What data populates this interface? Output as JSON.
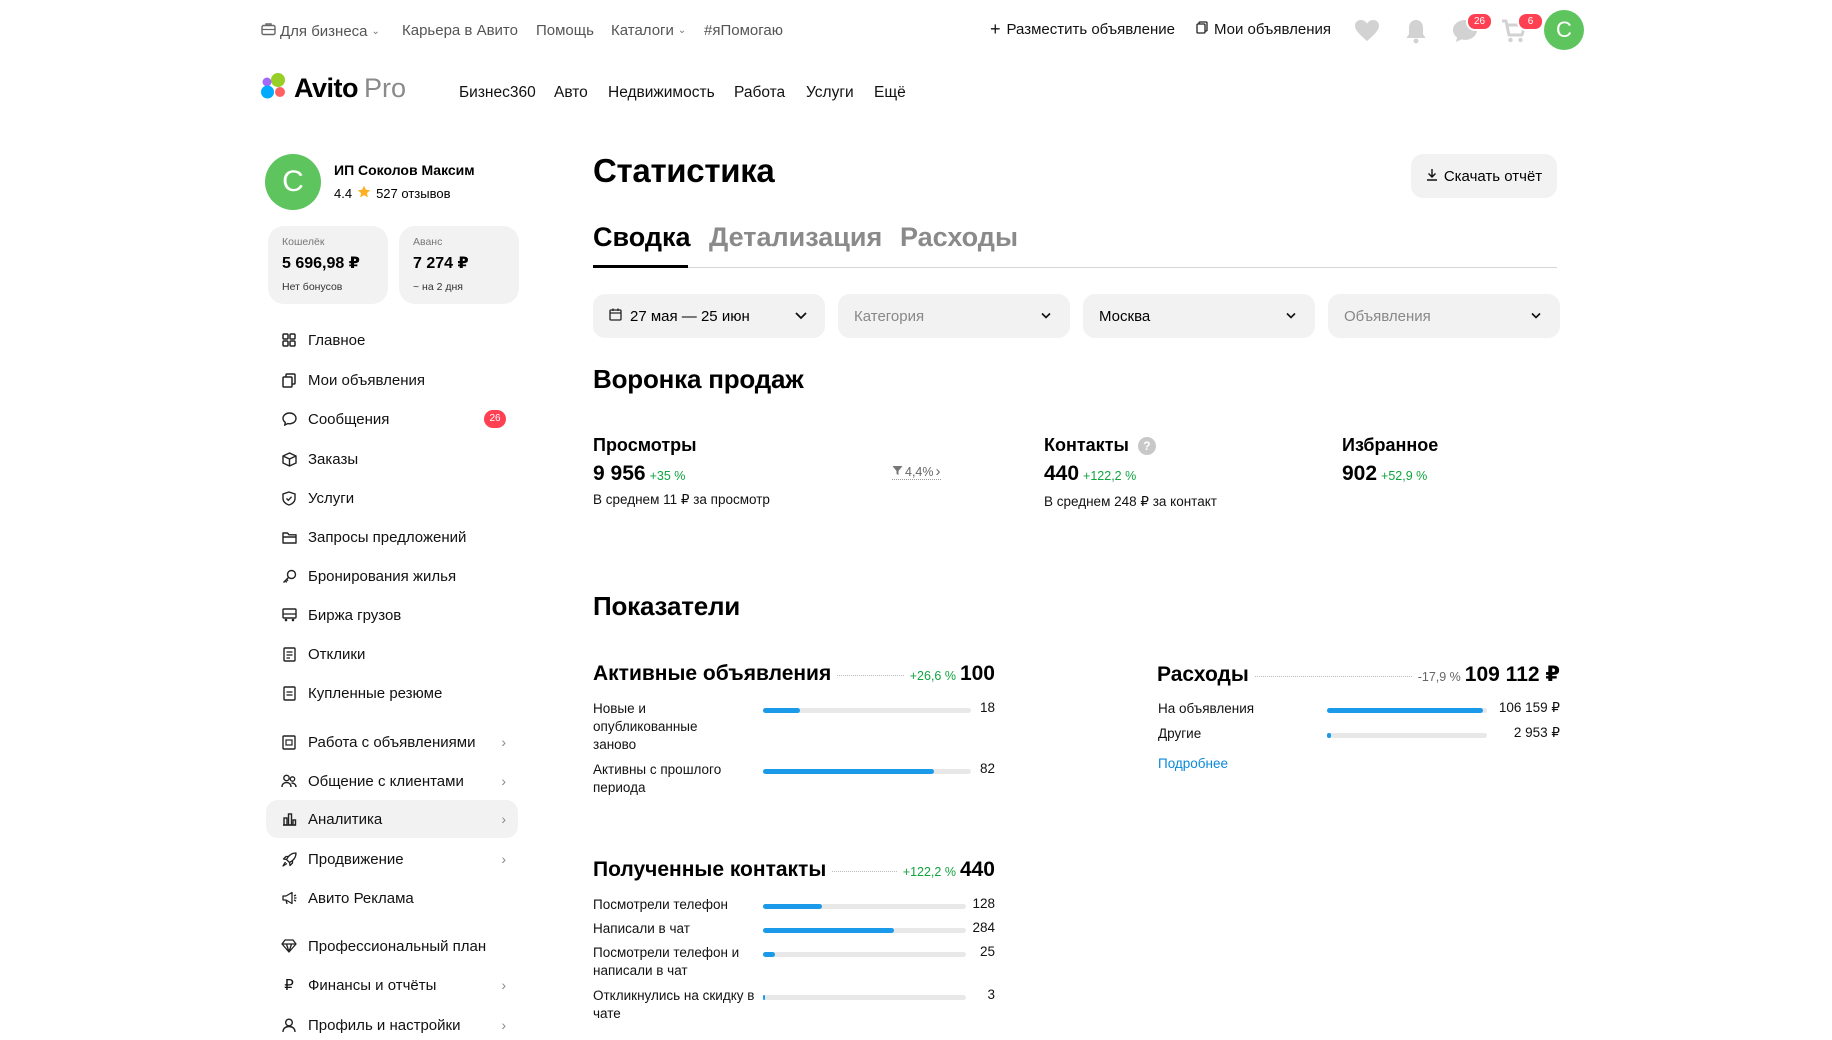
{
  "topbar": {
    "business": "Для бизнеса",
    "career": "Карьера в Авито",
    "help": "Помощь",
    "catalogs": "Каталоги",
    "helping": "#яПомогаю",
    "post_ad": "Разместить объявление",
    "my_ads": "Мои объявления",
    "messages_badge": "26",
    "cart_badge": "6",
    "avatar_letter": "C"
  },
  "logo": {
    "name": "Avito",
    "suffix": "Pro"
  },
  "mainnav": [
    "Бизнес360",
    "Авто",
    "Недвижимость",
    "Работа",
    "Услуги",
    "Ещё"
  ],
  "profile": {
    "avatar_letter": "C",
    "name": "ИП Соколов Максим",
    "rating": "4.4",
    "reviews": "527 отзывов"
  },
  "wallet": {
    "label": "Кошелёк",
    "value": "5 696,98 ₽",
    "sub": "Нет бонусов"
  },
  "advance": {
    "label": "Аванс",
    "value": "7 274 ₽",
    "sub": "~ на 2 дня"
  },
  "sidebar": {
    "items": [
      {
        "label": "Главное"
      },
      {
        "label": "Мои объявления"
      },
      {
        "label": "Сообщения",
        "badge": "26"
      },
      {
        "label": "Заказы"
      },
      {
        "label": "Услуги"
      },
      {
        "label": "Запросы предложений"
      },
      {
        "label": "Бронирования жилья"
      },
      {
        "label": "Биржа грузов"
      },
      {
        "label": "Отклики"
      },
      {
        "label": "Купленные резюме"
      },
      {
        "label": "Работа с объявлениями"
      },
      {
        "label": "Общение с клиентами"
      },
      {
        "label": "Аналитика"
      },
      {
        "label": "Продвижение"
      },
      {
        "label": "Авито Реклама"
      },
      {
        "label": "Профессиональный план"
      },
      {
        "label": "Финансы и отчёты"
      },
      {
        "label": "Профиль и настройки"
      }
    ]
  },
  "page": {
    "title": "Статистика",
    "download": "Скачать отчёт",
    "tabs": [
      "Сводка",
      "Детализация",
      "Расходы"
    ]
  },
  "filters": {
    "period": "27 мая — 25 июн",
    "category": "Категория",
    "city": "Москва",
    "ads": "Объявления"
  },
  "funnel": {
    "title": "Воронка продаж",
    "views": {
      "label": "Просмотры",
      "value": "9 956",
      "change": "+35 %",
      "sub": "В среднем 11 ₽ за просмотр"
    },
    "conversion": "4,4%",
    "contacts": {
      "label": "Контакты",
      "value": "440",
      "change": "+122,2 %",
      "sub": "В среднем 248 ₽ за контакт"
    },
    "favorites": {
      "label": "Избранное",
      "value": "902",
      "change": "+52,9 %"
    }
  },
  "indicators": {
    "title": "Показатели",
    "active_ads": {
      "title": "Активные объявления",
      "change": "+26,6 %",
      "value": "100",
      "rows": [
        {
          "label": "Новые и опубликованные заново",
          "value": "18",
          "fill": 0.18
        },
        {
          "label": "Активны с прошлого периода",
          "value": "82",
          "fill": 0.82
        }
      ]
    },
    "expenses": {
      "title": "Расходы",
      "change": "-17,9 %",
      "value": "109 112 ₽",
      "rows": [
        {
          "label": "На объявления",
          "value": "106 159 ₽",
          "fill": 0.973
        },
        {
          "label": "Другие",
          "value": "2 953 ₽",
          "fill": 0.027
        }
      ],
      "more": "Подробнее"
    },
    "contacts": {
      "title": "Полученные контакты",
      "change": "+122,2 %",
      "value": "440",
      "rows": [
        {
          "label": "Посмотрели телефон",
          "value": "128",
          "fill": 0.29
        },
        {
          "label": "Написали в чат",
          "value": "284",
          "fill": 0.645
        },
        {
          "label": "Посмотрели телефон и написали в чат",
          "value": "25",
          "fill": 0.057
        },
        {
          "label": "Откликнулись на скидку в чате",
          "value": "3",
          "fill": 0.007
        }
      ]
    }
  },
  "colors": {
    "accent": "#1a9ae9",
    "positive": "#10a33e",
    "badge": "#ff4053",
    "avatar": "#5ec55e",
    "link": "#0a8ad8"
  }
}
